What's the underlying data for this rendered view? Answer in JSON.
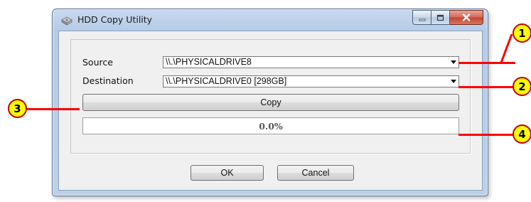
{
  "window": {
    "title": "HDD Copy Utility",
    "icon": "hard-drive-icon",
    "controls": {
      "minimize": "minimize-icon",
      "maximize": "maximize-icon",
      "close": "close-icon"
    }
  },
  "form": {
    "source_label": "Source",
    "source_value": "\\\\.\\PHYSICALDRIVE8",
    "destination_label": "Destination",
    "destination_value": "\\\\.\\PHYSICALDRIVE0 [298GB]",
    "copy_label": "Copy",
    "progress_text": "0.0%",
    "progress_value": 0.0,
    "ok_label": "OK",
    "cancel_label": "Cancel"
  },
  "callouts": [
    "1",
    "2",
    "3",
    "4"
  ],
  "colors": {
    "callout_fill": "#ffff00",
    "callout_line": "#ff0000",
    "close_button": "#c1442f"
  }
}
